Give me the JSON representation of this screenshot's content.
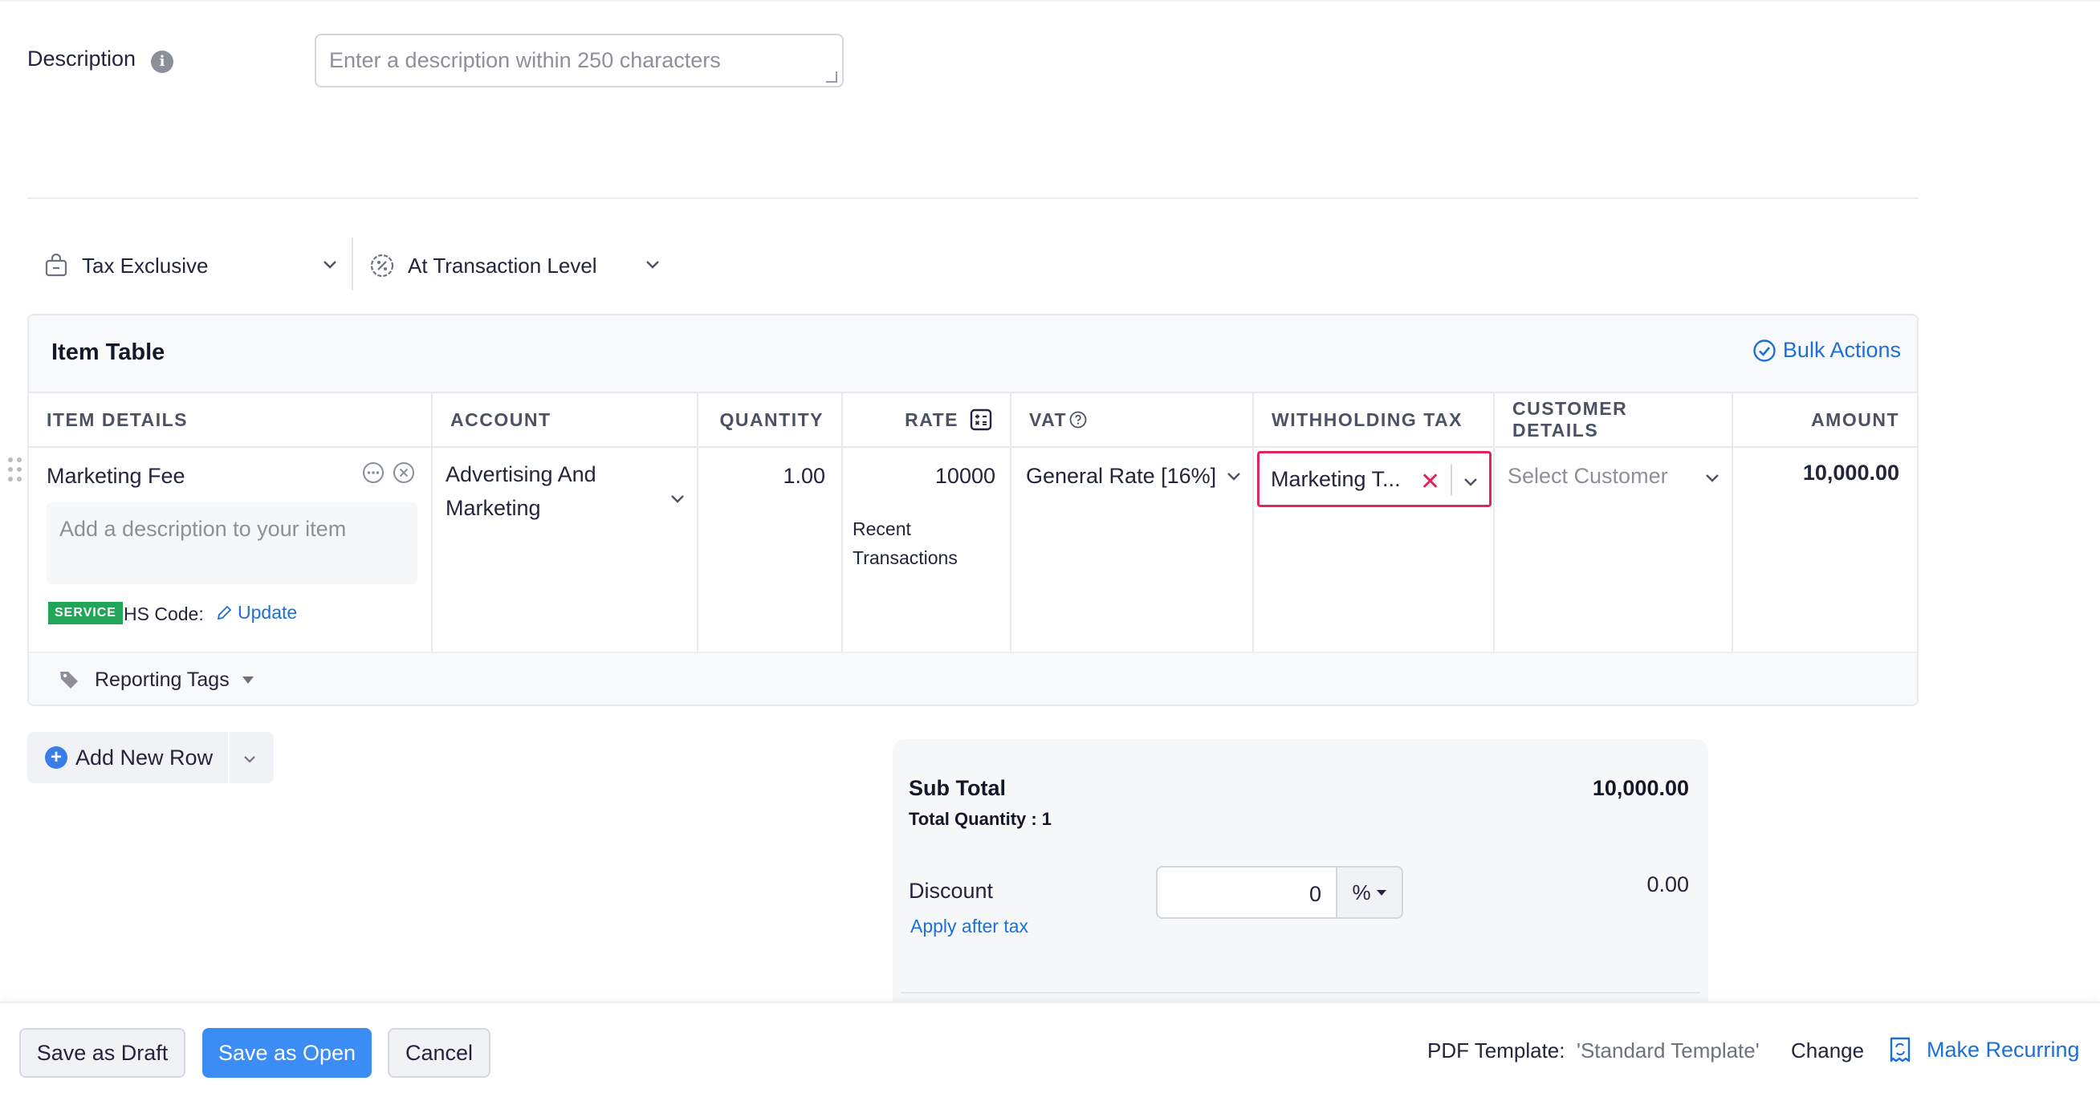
{
  "description": {
    "label": "Description",
    "placeholder": "Enter a description within 250 characters"
  },
  "tax_mode": {
    "value": "Tax Exclusive"
  },
  "discount_level": {
    "value": "At Transaction Level"
  },
  "item_table": {
    "title": "Item Table",
    "bulk_actions": "Bulk Actions",
    "columns": {
      "item_details": "ITEM DETAILS",
      "account": "ACCOUNT",
      "quantity": "QUANTITY",
      "rate": "RATE",
      "vat": "VAT",
      "withholding_tax": "WITHHOLDING TAX",
      "customer_details": "CUSTOMER DETAILS",
      "amount": "AMOUNT"
    },
    "row": {
      "item_name": "Marketing Fee",
      "item_description_placeholder": "Add a description to your item",
      "badge": "SERVICE",
      "hs_code_label": "HS Code:",
      "hs_update": "Update",
      "account_line1": "Advertising And",
      "account_line2": "Marketing",
      "quantity": "1.00",
      "rate": "10000",
      "recent_line1": "Recent",
      "recent_line2": "Transactions",
      "vat": "General Rate [16%]",
      "withholding_tax": "Marketing T...",
      "customer_placeholder": "Select Customer",
      "amount": "10,000.00"
    },
    "reporting_tags": "Reporting Tags"
  },
  "add_new_row": "Add New Row",
  "totals": {
    "sub_total_label": "Sub Total",
    "sub_total_value": "10,000.00",
    "total_quantity": "Total Quantity : 1",
    "discount_label": "Discount",
    "discount_value": "0",
    "discount_unit": "%",
    "apply_after_tax": "Apply after tax",
    "discount_amount": "0.00"
  },
  "footer": {
    "save_draft": "Save as Draft",
    "save_open": "Save as Open",
    "cancel": "Cancel",
    "pdf_label": "PDF Template:",
    "pdf_value": "'Standard Template'",
    "change": "Change",
    "make_recurring": "Make Recurring"
  },
  "colors": {
    "accent": "#1d6fd8",
    "primary_button": "#3b8cf4",
    "error_border": "#e0245e",
    "service_badge": "#22a559"
  }
}
